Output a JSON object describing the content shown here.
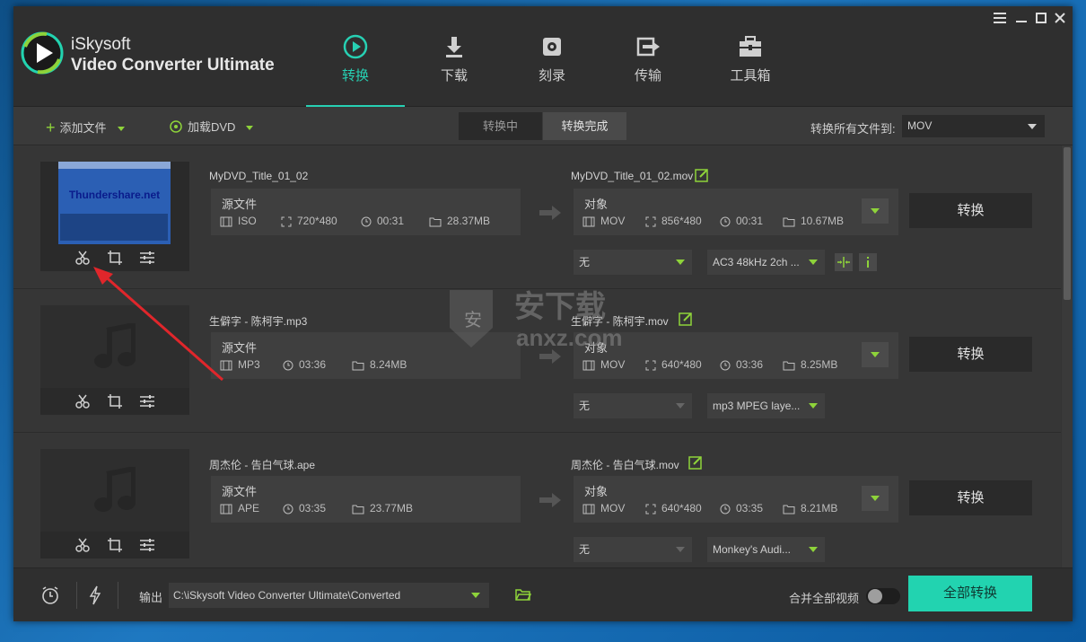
{
  "app": {
    "name_line1": "iSkysoft",
    "name_line2": "Video Converter Ultimate"
  },
  "window_controls": [
    "menu-icon",
    "minimize-icon",
    "maximize-icon",
    "close-icon"
  ],
  "nav": {
    "tabs": [
      {
        "label": "转换",
        "icon": "convert-icon",
        "active": true
      },
      {
        "label": "下载",
        "icon": "download-icon",
        "active": false
      },
      {
        "label": "刻录",
        "icon": "burn-icon",
        "active": false
      },
      {
        "label": "传输",
        "icon": "transfer-icon",
        "active": false
      },
      {
        "label": "工具箱",
        "icon": "toolbox-icon",
        "active": false
      }
    ]
  },
  "toolbar": {
    "add_file": "添加文件",
    "load_dvd": "加载DVD",
    "seg_converting": "转换中",
    "seg_done": "转换完成",
    "convert_all_to": "转换所有文件到:",
    "format": "MOV"
  },
  "items": [
    {
      "src_name": "MyDVD_Title_01_02",
      "src_label": "源文件",
      "src_format": "ISO",
      "src_res": "720*480",
      "src_duration": "00:31",
      "src_size": "28.37MB",
      "dst_name": "MyDVD_Title_01_02.mov",
      "dst_label": "对象",
      "dst_format": "MOV",
      "dst_res": "856*480",
      "dst_duration": "00:31",
      "dst_size": "10.67MB",
      "subtitle": "无",
      "audio": "AC3 48kHz 2ch ...",
      "convert": "转换",
      "thumb_text": "Thundershare.net"
    },
    {
      "src_name": "生僻字 - 陈柯宇.mp3",
      "src_label": "源文件",
      "src_format": "MP3",
      "src_duration": "03:36",
      "src_size": "8.24MB",
      "dst_name": "生僻字 - 陈柯宇.mov",
      "dst_label": "对象",
      "dst_format": "MOV",
      "dst_res": "640*480",
      "dst_duration": "03:36",
      "dst_size": "8.25MB",
      "subtitle": "无",
      "audio": "mp3 MPEG laye...",
      "convert": "转换"
    },
    {
      "src_name": "周杰伦 - 告白气球.ape",
      "src_label": "源文件",
      "src_format": "APE",
      "src_duration": "03:35",
      "src_size": "23.77MB",
      "dst_name": "周杰伦 - 告白气球.mov",
      "dst_label": "对象",
      "dst_format": "MOV",
      "dst_res": "640*480",
      "dst_duration": "03:35",
      "dst_size": "8.21MB",
      "subtitle": "无",
      "audio": "Monkey's Audi...",
      "convert": "转换"
    }
  ],
  "bottom": {
    "output_label": "输出",
    "output_path": "C:\\iSkysoft Video Converter Ultimate\\Converted",
    "merge_label": "合并全部视频",
    "merge_on": false,
    "convert_all": "全部转换"
  },
  "watermark": {
    "text": "anxz.com"
  },
  "colors": {
    "accent": "#27d0b3",
    "green": "#8ed33a",
    "annotation_arrow": "#e0262b"
  }
}
